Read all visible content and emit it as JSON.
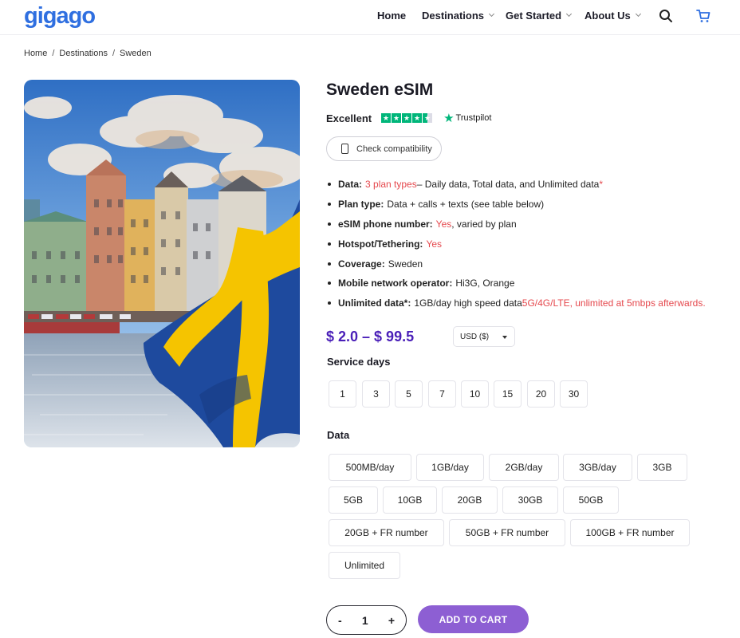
{
  "brand": {
    "logo_text": "gigago"
  },
  "nav": {
    "items": [
      {
        "label": "Home",
        "has_dropdown": false
      },
      {
        "label": "Destinations",
        "has_dropdown": true
      },
      {
        "label": "Get Started",
        "has_dropdown": true
      },
      {
        "label": "About Us",
        "has_dropdown": true
      }
    ],
    "icons": [
      "search-icon",
      "cart-icon"
    ]
  },
  "breadcrumb": [
    "Home",
    "Destinations",
    "Sweden"
  ],
  "product": {
    "title": "Sweden eSIM",
    "rating_text": "Excellent",
    "trustpilot_label": "Trustpilot",
    "compat_button": "Check compatibility",
    "features": [
      {
        "label": "Data:",
        "parts": [
          {
            "text": "3 plan types",
            "red": true
          },
          {
            "text": " – Daily data, Total data, and Unlimited data",
            "red": false
          },
          {
            "text": "*",
            "red": true
          }
        ]
      },
      {
        "label": "Plan type:",
        "parts": [
          {
            "text": "Data + calls + texts (see table below)",
            "red": false
          }
        ]
      },
      {
        "label": "eSIM phone number:",
        "parts": [
          {
            "text": "Yes",
            "red": true
          },
          {
            "text": ", varied by plan",
            "red": false
          }
        ]
      },
      {
        "label": "Hotspot/Tethering:",
        "parts": [
          {
            "text": "Yes",
            "red": true
          }
        ]
      },
      {
        "label": "Coverage:",
        "parts": [
          {
            "text": "Sweden",
            "red": false
          }
        ]
      },
      {
        "label": "Mobile network operator:",
        "parts": [
          {
            "text": "Hi3G, Orange",
            "red": false
          }
        ]
      },
      {
        "label": "Unlimited data*:",
        "parts": [
          {
            "text": "1GB/day high speed data ",
            "red": false
          },
          {
            "text": "5G/4G/LTE, unlimited at 5mbps afterwards.",
            "red": true
          }
        ]
      }
    ],
    "price": "$ 2.0 – $ 99.5",
    "currency": "USD ($)",
    "service_days_label": "Service days",
    "service_days": [
      "1",
      "3",
      "5",
      "7",
      "10",
      "15",
      "20",
      "30"
    ],
    "data_label": "Data",
    "data_options": [
      [
        "500MB/day",
        "1GB/day",
        "2GB/day",
        "3GB/day",
        "3GB"
      ],
      [
        "5GB",
        "10GB",
        "20GB",
        "30GB",
        "50GB"
      ],
      [
        "20GB + FR number",
        "50GB + FR number",
        "100GB + FR number"
      ],
      [
        "Unlimited"
      ]
    ],
    "quantity": "1",
    "qty_minus": "-",
    "qty_plus": "+",
    "add_to_cart": "ADD TO CART"
  },
  "colors": {
    "accent": "#4a1fb8",
    "button": "#8d5fd3",
    "highlight": "#e5484d",
    "trustpilot": "#00b67a",
    "brand_blue": "#2f6fe0"
  }
}
